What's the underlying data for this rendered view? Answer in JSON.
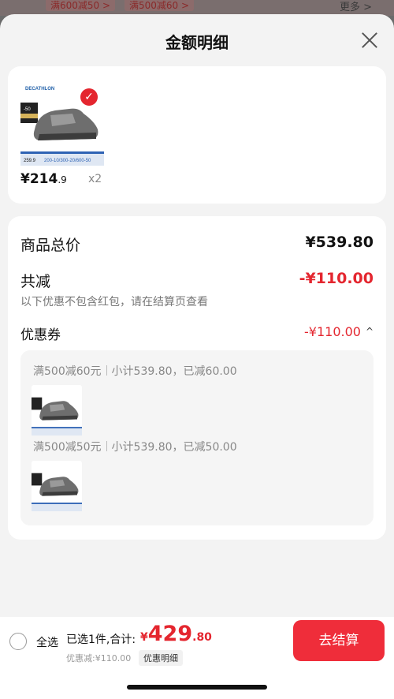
{
  "background": {
    "chips": [
      "满600减50 >",
      "满500减60 >"
    ],
    "more": "更多 >"
  },
  "sheet": {
    "title": "金额明细",
    "close_icon": "close-icon"
  },
  "product": {
    "brand": "DECATHLON",
    "promo_label": "200-10/300-20/600-50",
    "price_tag": "259.9",
    "price_int": "¥214",
    "price_dec": ".9",
    "qty": "x2",
    "checked": true
  },
  "summary": {
    "total_label": "商品总价",
    "total_value": "¥539.80",
    "reduce_label": "共减",
    "reduce_value": "-¥110.00",
    "note": "以下优惠不包含红包，请在结算页查看",
    "coupon_label": "优惠券",
    "coupon_value": "-¥110.00",
    "coupon_chevron": "^"
  },
  "coupons": [
    {
      "rule": "满500减60元",
      "detail": "小计539.80，已减60.00"
    },
    {
      "rule": "满500减50元",
      "detail": "小计539.80，已减50.00"
    }
  ],
  "bottom": {
    "select_all": "全选",
    "selected": "已选1件,合计:",
    "currency": "¥",
    "amount_int": "429",
    "amount_dec": ".80",
    "discount": "优惠减:¥110.00",
    "detail_tag": "优惠明细",
    "checkout": "去结算"
  },
  "colors": {
    "accent": "#e4262f",
    "button": "#ef2d3a"
  }
}
